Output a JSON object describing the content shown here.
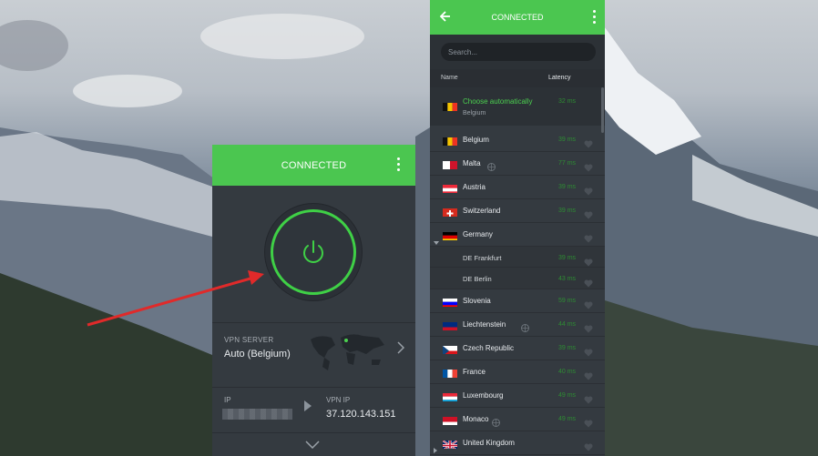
{
  "app": {
    "status": "CONNECTED",
    "server_label": "VPN SERVER",
    "server_value": "Auto (Belgium)",
    "ip_label": "IP",
    "vpn_ip_label": "VPN IP",
    "vpn_ip_value": "37.120.143.151",
    "accent": "#4bc650"
  },
  "list": {
    "status": "CONNECTED",
    "search_placeholder": "Search...",
    "col_name": "Name",
    "col_latency": "Latency",
    "auto": {
      "title": "Choose automatically",
      "sub": "Belgium",
      "latency": "32 ms"
    },
    "rows": [
      {
        "name": "Belgium",
        "flag": "be",
        "latency": "39 ms"
      },
      {
        "name": "Malta",
        "flag": "mt",
        "latency": "77 ms",
        "virtual": true
      },
      {
        "name": "Austria",
        "flag": "at",
        "latency": "39 ms"
      },
      {
        "name": "Switzerland",
        "flag": "ch",
        "latency": "39 ms"
      },
      {
        "name": "Germany",
        "flag": "de",
        "latency": "",
        "expanded": true
      },
      {
        "name": "DE Frankfurt",
        "flag": "",
        "latency": "39 ms",
        "sub": true
      },
      {
        "name": "DE Berlin",
        "flag": "",
        "latency": "43 ms",
        "sub": true
      },
      {
        "name": "Slovenia",
        "flag": "si",
        "latency": "59 ms"
      },
      {
        "name": "Liechtenstein",
        "flag": "li",
        "latency": "44 ms",
        "virtual": true
      },
      {
        "name": "Czech Republic",
        "flag": "cz",
        "latency": "39 ms"
      },
      {
        "name": "France",
        "flag": "fr",
        "latency": "40 ms"
      },
      {
        "name": "Luxembourg",
        "flag": "lu",
        "latency": "49 ms"
      },
      {
        "name": "Monaco",
        "flag": "mc",
        "latency": "49 ms",
        "virtual": true
      },
      {
        "name": "United Kingdom",
        "flag": "gb",
        "latency": "",
        "collapsed": true
      }
    ]
  }
}
